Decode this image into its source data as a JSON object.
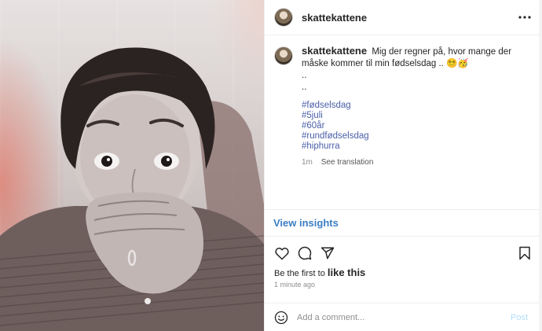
{
  "post": {
    "username": "skattekattene",
    "caption": {
      "text": "Mig der regner på, hvor mange der måske kommer til min fødselsdag .. 😵‍💫🥳",
      "extra_lines": [
        "..",
        ".."
      ],
      "hashtags": [
        "#fødselsdag",
        "#5juli",
        "#60år",
        "#rundfødselsdag",
        "#hiphurra"
      ]
    },
    "meta": {
      "age": "1m",
      "translate_label": "See translation"
    },
    "insights_label": "View insights",
    "likes": {
      "prefix": "Be the first to",
      "action": "like this"
    },
    "timestamp": "1 minute ago",
    "comment": {
      "placeholder": "Add a comment...",
      "post_label": "Post"
    },
    "icons": {
      "more": "more-options-icon",
      "like": "heart-icon",
      "comment": "comment-icon",
      "share": "send-icon",
      "save": "bookmark-icon",
      "emoji": "emoji-icon"
    },
    "colors": {
      "hashtag": "#4a5fa8",
      "insights": "#3b7ec4",
      "post_disabled": "#b2dffc",
      "secondary_text": "#8e8e8e"
    }
  }
}
